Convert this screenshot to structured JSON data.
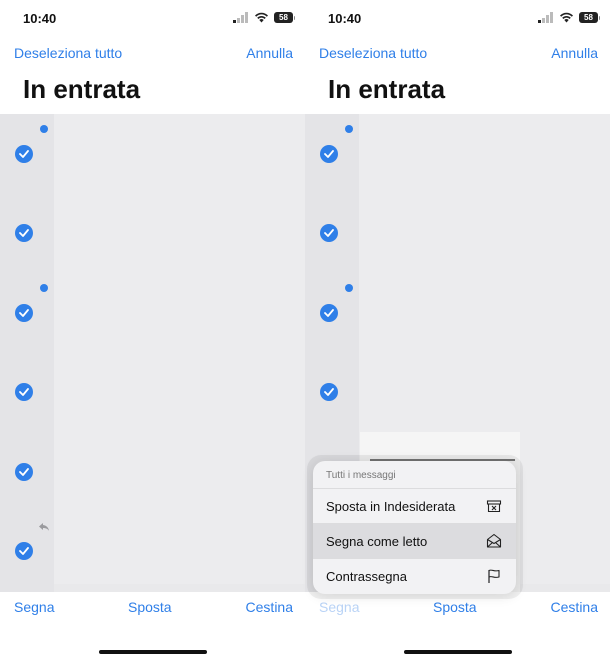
{
  "status_bar": {
    "time": "10:40",
    "battery": "58"
  },
  "nav": {
    "deselect_all": "Deseleziona tutto",
    "cancel": "Annulla"
  },
  "mailbox_title": "In entrata",
  "toolbar": {
    "mark": "Segna",
    "move": "Sposta",
    "trash": "Cestina"
  },
  "menu": {
    "header": "Tutti i messaggi",
    "items": [
      {
        "label": "Sposta in Indesiderata",
        "icon": "junk-box-icon"
      },
      {
        "label": "Segna come letto",
        "icon": "open-envelope-icon"
      },
      {
        "label": "Contrassegna",
        "icon": "flag-icon"
      }
    ]
  },
  "colors": {
    "accent": "#2f7fe8",
    "background": "#ffffff",
    "list_bg": "#e9e9eb"
  }
}
